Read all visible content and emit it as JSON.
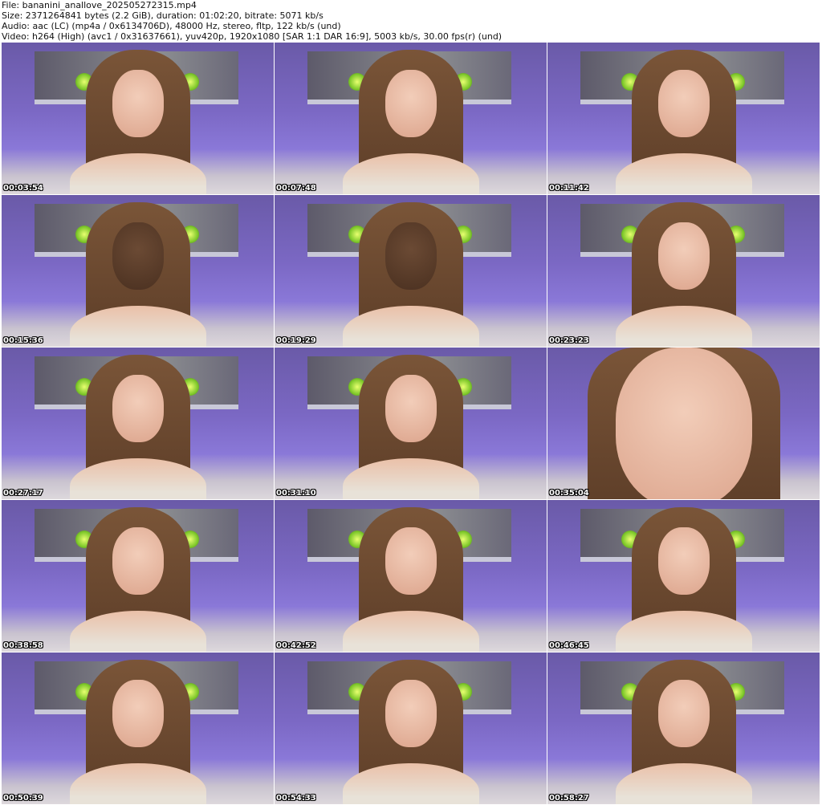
{
  "header": {
    "file": "File: bananini_anallove_202505272315.mp4",
    "size": "Size: 2371264841 bytes (2.2 GiB), duration: 01:02:20, bitrate: 5071 kb/s",
    "audio": "Audio: aac (LC) (mp4a / 0x6134706D), 48000 Hz, stereo, fltp, 122 kb/s (und)",
    "video": "Video: h264 (High) (avc1 / 0x31637661), yuv420p, 1920x1080 [SAR 1:1 DAR 16:9], 5003 kb/s, 30.00 fps(r) (und)"
  },
  "thumbnails": [
    {
      "timestamp": "00:03:54",
      "variant": "normal"
    },
    {
      "timestamp": "00:07:48",
      "variant": "normal"
    },
    {
      "timestamp": "00:11:42",
      "variant": "normal"
    },
    {
      "timestamp": "00:15:36",
      "variant": "down"
    },
    {
      "timestamp": "00:19:29",
      "variant": "down"
    },
    {
      "timestamp": "00:23:23",
      "variant": "normal"
    },
    {
      "timestamp": "00:27:17",
      "variant": "normal"
    },
    {
      "timestamp": "00:31:10",
      "variant": "normal"
    },
    {
      "timestamp": "00:35:04",
      "variant": "closeup"
    },
    {
      "timestamp": "00:38:58",
      "variant": "normal"
    },
    {
      "timestamp": "00:42:52",
      "variant": "normal"
    },
    {
      "timestamp": "00:46:45",
      "variant": "normal"
    },
    {
      "timestamp": "00:50:39",
      "variant": "normal"
    },
    {
      "timestamp": "00:54:33",
      "variant": "normal"
    },
    {
      "timestamp": "00:58:27",
      "variant": "normal"
    }
  ]
}
